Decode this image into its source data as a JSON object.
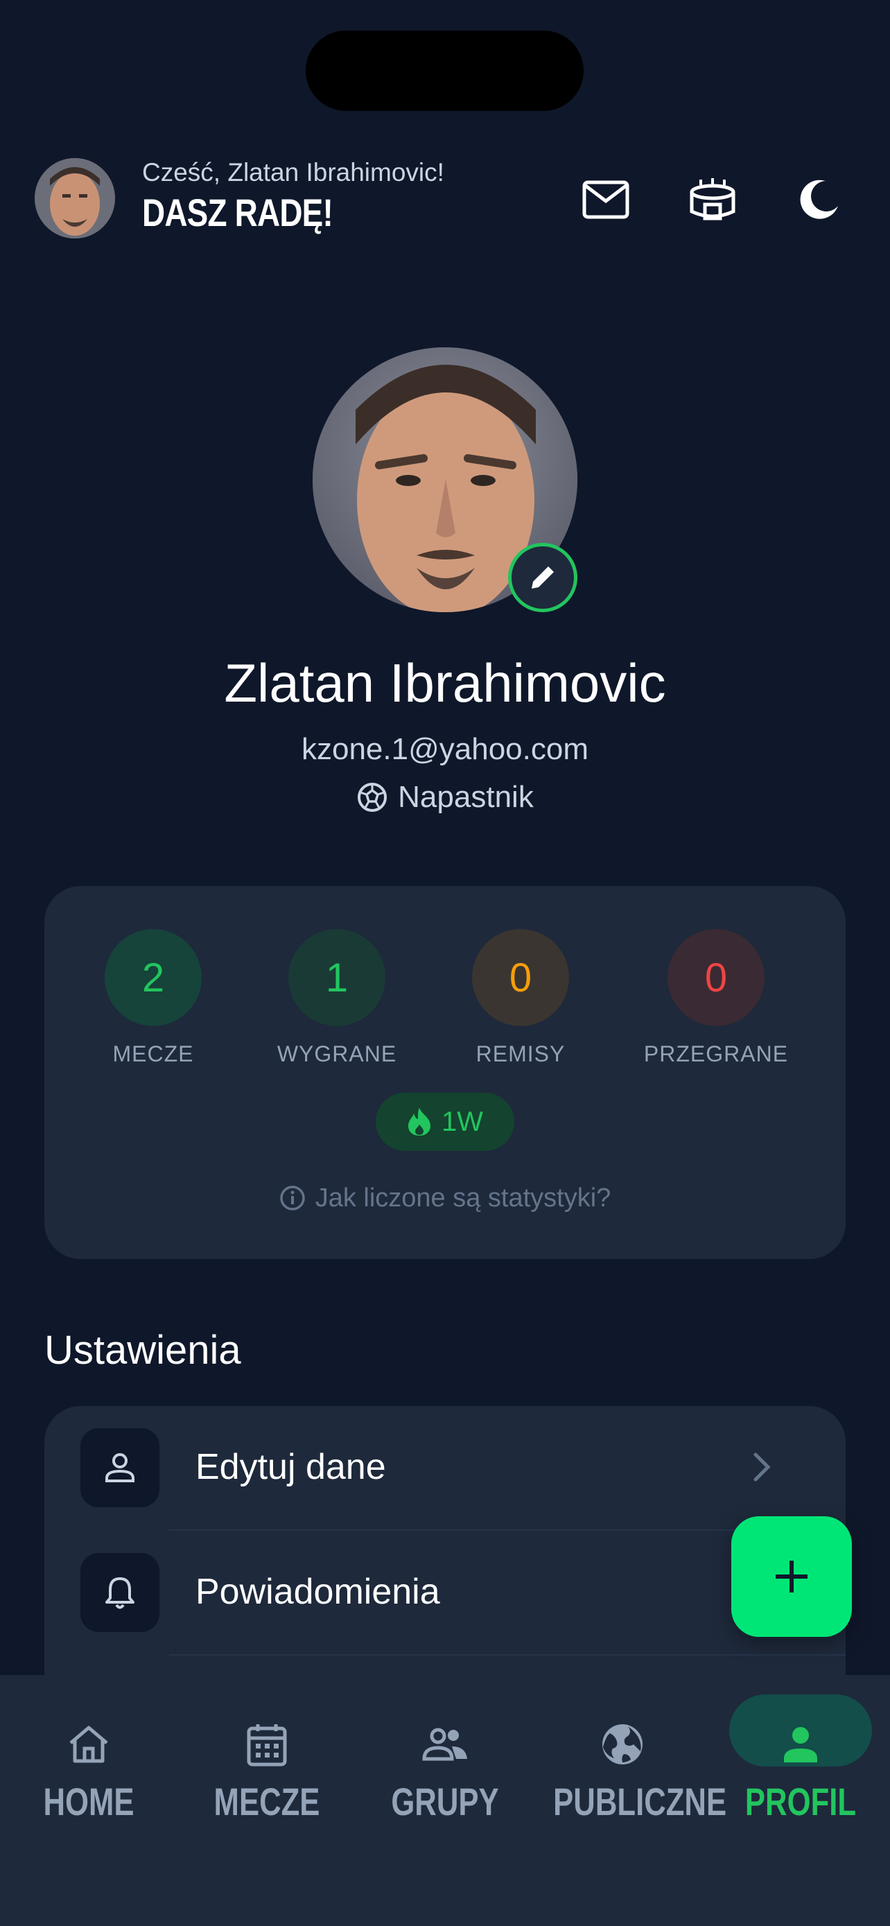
{
  "header": {
    "greeting": "Cześć, Zlatan Ibrahimovic!",
    "motto": "DASZ RADĘ!"
  },
  "profile": {
    "name": "Zlatan Ibrahimovic",
    "email": "kzone.1@yahoo.com",
    "position": "Napastnik"
  },
  "stats": {
    "items": [
      {
        "value": "2",
        "label": "MECZE",
        "color": "#22c55e",
        "bg": "#16433a"
      },
      {
        "value": "1",
        "label": "WYGRANE",
        "color": "#22c55e",
        "bg": "#1a3a36"
      },
      {
        "value": "0",
        "label": "REMISY",
        "color": "#f59e0b",
        "bg": "#3a3530"
      },
      {
        "value": "0",
        "label": "PRZEGRANE",
        "color": "#ef4444",
        "bg": "#3a2a33"
      }
    ],
    "streak": "1W",
    "help": "Jak liczone są statystyki?"
  },
  "settings": {
    "title": "Ustawienia",
    "items": [
      {
        "label": "Edytuj dane"
      },
      {
        "label": "Powiadomienia"
      }
    ]
  },
  "nav": {
    "items": [
      {
        "label": "HOME"
      },
      {
        "label": "MECZE"
      },
      {
        "label": "GRUPY"
      },
      {
        "label": "PUBLICZNE"
      },
      {
        "label": "PROFIL"
      }
    ],
    "active": "PROFIL"
  },
  "colors": {
    "background": "#0f172a",
    "card": "#1e293b",
    "accent": "#22c55e",
    "fab": "#00e676"
  }
}
